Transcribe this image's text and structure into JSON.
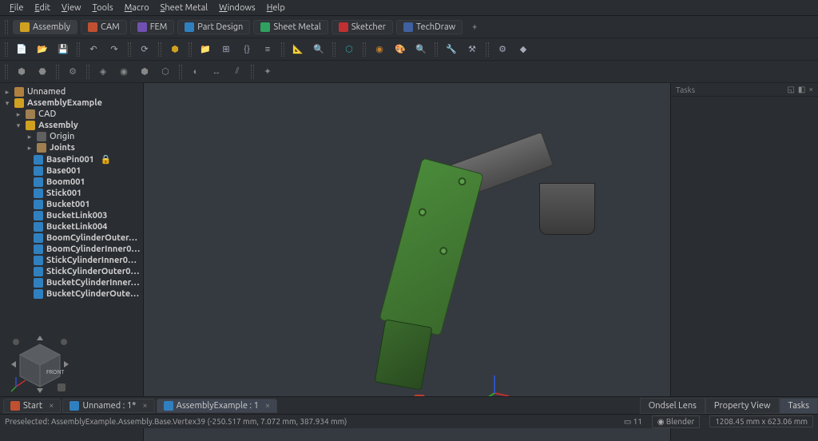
{
  "menu": {
    "items": [
      "File",
      "Edit",
      "View",
      "Tools",
      "Macro",
      "Sheet Metal",
      "Windows",
      "Help"
    ],
    "accel": [
      0,
      0,
      0,
      0,
      0,
      0,
      0,
      0
    ]
  },
  "workbenches": [
    {
      "label": "Assembly",
      "color": "#d0a020",
      "active": true
    },
    {
      "label": "CAM",
      "color": "#c05030"
    },
    {
      "label": "FEM",
      "color": "#7050b0"
    },
    {
      "label": "Part Design",
      "color": "#3080c0"
    },
    {
      "label": "Sheet Metal",
      "color": "#30a060"
    },
    {
      "label": "Sketcher",
      "color": "#c03030"
    },
    {
      "label": "TechDraw",
      "color": "#4060a0"
    }
  ],
  "tree": {
    "root1": {
      "label": "Unnamed",
      "icon": "#b08040"
    },
    "root2": {
      "label": "AssemblyExample",
      "icon": "#d0a020"
    },
    "cad": {
      "label": "CAD"
    },
    "assembly": {
      "label": "Assembly",
      "icon": "#d0a020"
    },
    "origin": {
      "label": "Origin"
    },
    "joints": {
      "label": "Joints"
    },
    "parts": [
      "BasePin001",
      "Base001",
      "Boom001",
      "Stick001",
      "Bucket001",
      "BucketLink003",
      "BucketLink004",
      "BoomCylinderOuter…",
      "BoomCylinderInner0…",
      "StickCylinderInner0…",
      "StickCylinderOuter0…",
      "BucketCylinderInner…",
      "BucketCylinderOute…"
    ],
    "locked_idx": 0
  },
  "task_panel": {
    "title": "Tasks"
  },
  "doc_tabs": [
    {
      "label": "Start",
      "icon": "#c05030",
      "active": false
    },
    {
      "label": "Unnamed : 1*",
      "icon": "#3080c0",
      "active": false
    },
    {
      "label": "AssemblyExample : 1",
      "icon": "#3080c0",
      "active": true
    }
  ],
  "right_tabs": [
    "Ondsel Lens",
    "Property View",
    "Tasks"
  ],
  "right_tab_active": 2,
  "status": {
    "preselect": "Preselected: AssemblyExample.Assembly.Base.Vertex39 (-250.517 mm, 7.072 mm, 387.934 mm)",
    "instances": "11",
    "nav_style": "Blender",
    "dimensions": "1208.45 mm x 623.06 mm"
  }
}
